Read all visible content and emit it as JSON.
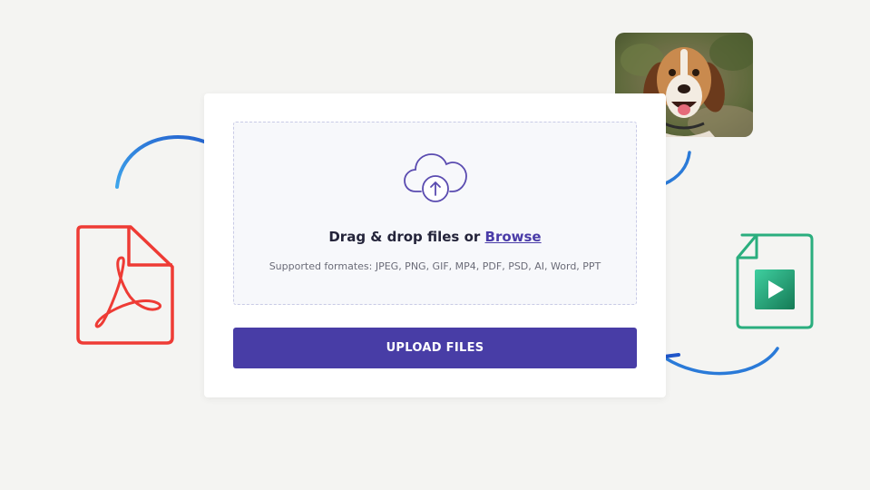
{
  "uploader": {
    "drag_text": "Drag & drop files or",
    "browse_label": "Browse",
    "supported_formats": "Supported formates: JPEG, PNG, GIF, MP4, PDF, PSD, AI, Word, PPT",
    "upload_button_label": "UPLOAD FILES"
  },
  "icons": {
    "upload": "cloud-upload-icon",
    "pdf": "pdf-file-icon",
    "video": "video-file-icon",
    "image": "dog-photo-thumbnail"
  },
  "colors": {
    "background": "#f4f4f2",
    "accent": "#483da6",
    "browse_link": "#4a3ca8",
    "pdf_red": "#ee3b35",
    "video_green": "#1f9a6a",
    "arrow_blue": "#2a7ad8"
  }
}
